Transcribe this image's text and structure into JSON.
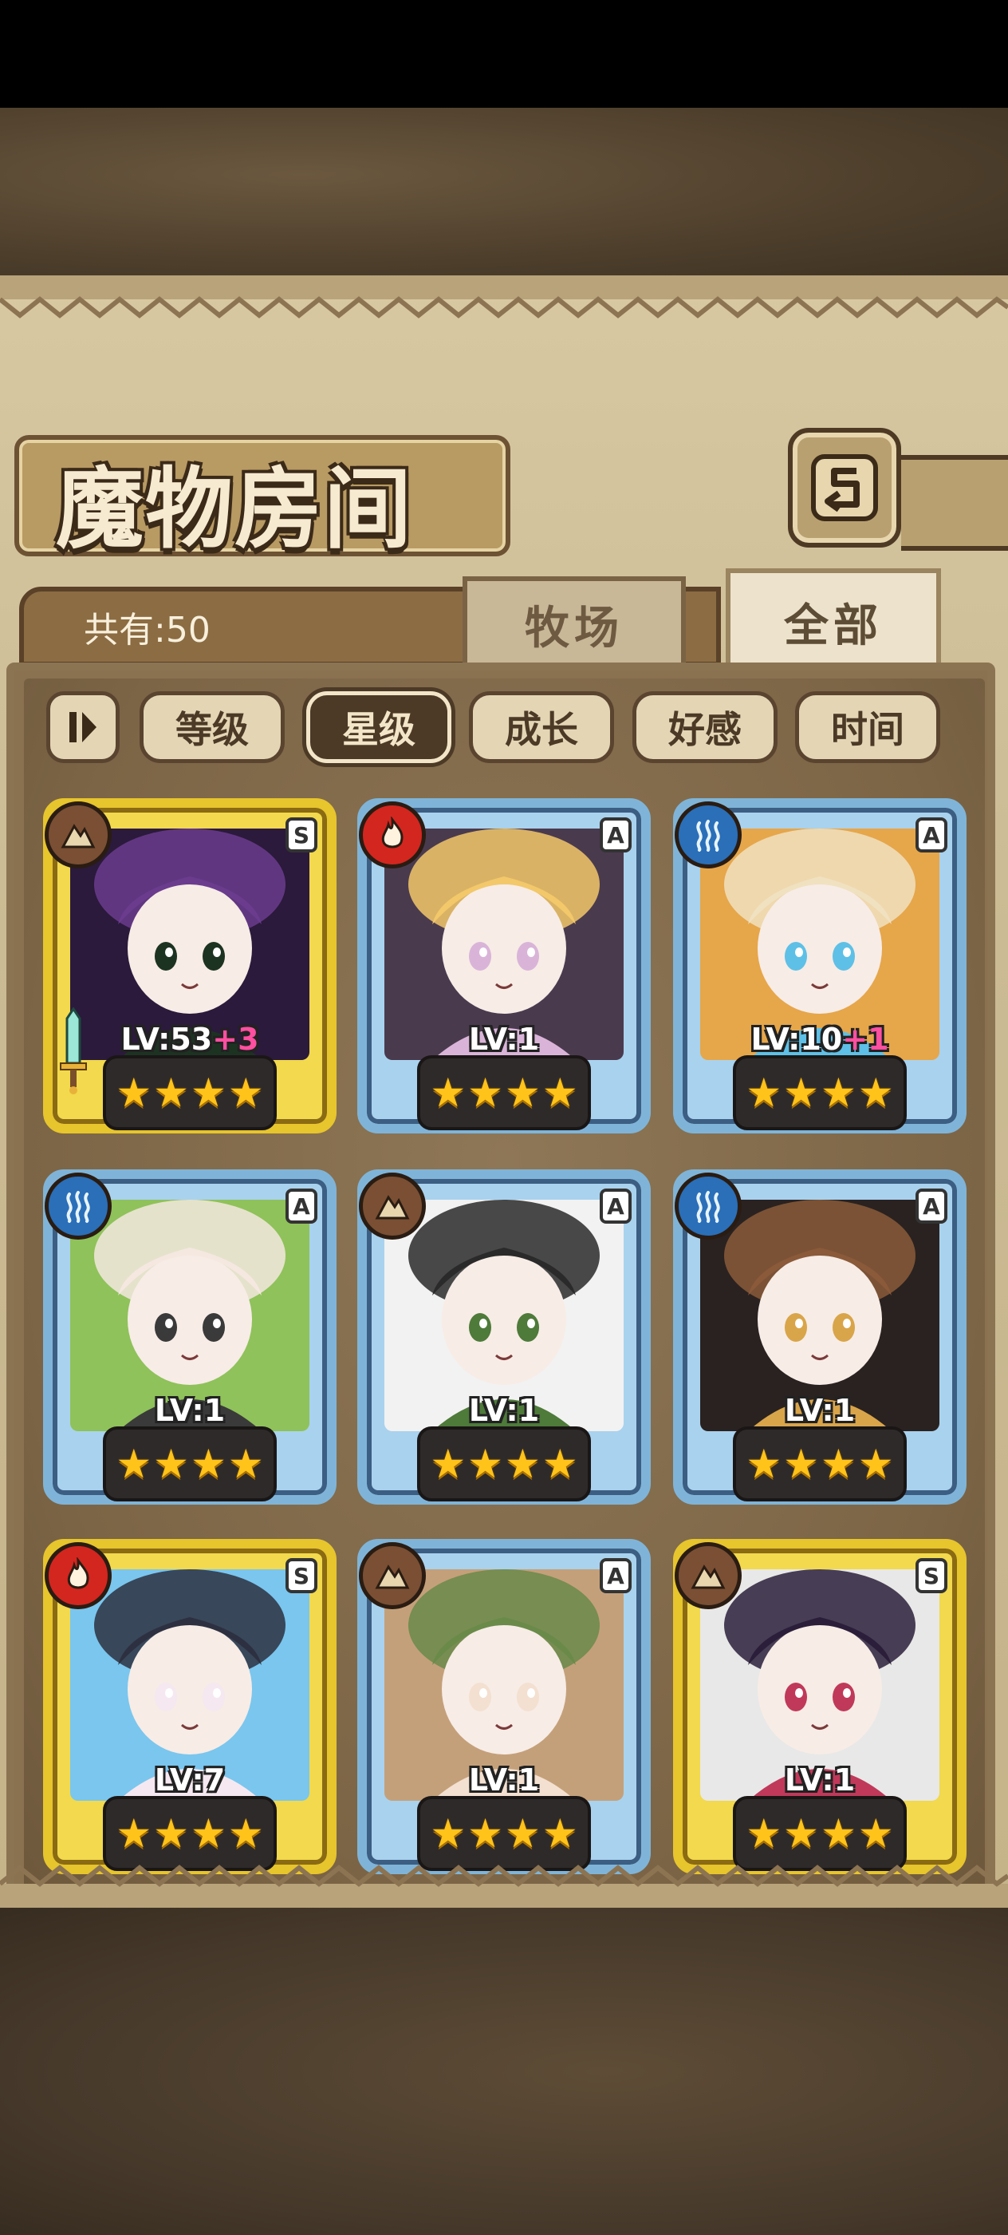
{
  "header": {
    "title": "魔物房间",
    "back_icon": "back-arrow-icon"
  },
  "summary": {
    "count_label": "共有:50"
  },
  "tabs": [
    {
      "label": "牧场",
      "active": false
    },
    {
      "label": "全部",
      "active": true
    }
  ],
  "sort_buttons": [
    {
      "label": "等级",
      "active": false
    },
    {
      "label": "星级",
      "active": true
    },
    {
      "label": "成长",
      "active": false
    },
    {
      "label": "好感",
      "active": false
    },
    {
      "label": "时间",
      "active": false
    }
  ],
  "cards": [
    {
      "level_text": "LV:53",
      "bonus": "+3",
      "rank": "S",
      "element": "earth",
      "stars": 4,
      "portrait_colors": [
        "#2b1a3b",
        "#6b3c8e",
        "#1d3322"
      ],
      "weapon": true
    },
    {
      "level_text": "LV:1",
      "bonus": "",
      "rank": "A",
      "element": "fire",
      "stars": 4,
      "portrait_colors": [
        "#4a3a4e",
        "#f2c86a",
        "#d9b4d8"
      ]
    },
    {
      "level_text": "LV:10",
      "bonus": "+1",
      "rank": "A",
      "element": "water",
      "stars": 4,
      "portrait_colors": [
        "#e6a64a",
        "#f0e1c0",
        "#5ec0e6"
      ]
    },
    {
      "level_text": "LV:1",
      "bonus": "",
      "rank": "A",
      "element": "water",
      "stars": 4,
      "portrait_colors": [
        "#8fc25a",
        "#f5e8e0",
        "#3a3a3a"
      ]
    },
    {
      "level_text": "LV:1",
      "bonus": "",
      "rank": "A",
      "element": "earth",
      "stars": 4,
      "portrait_colors": [
        "#f2f2f2",
        "#2a2a2a",
        "#4e7a3a"
      ]
    },
    {
      "level_text": "LV:1",
      "bonus": "",
      "rank": "A",
      "element": "water",
      "stars": 4,
      "portrait_colors": [
        "#2a2220",
        "#8a5a3a",
        "#d9a54a"
      ]
    },
    {
      "level_text": "LV:7",
      "bonus": "",
      "rank": "S",
      "element": "fire",
      "stars": 4,
      "portrait_colors": [
        "#7ac6ee",
        "#2d3040",
        "#f6e8f0"
      ]
    },
    {
      "level_text": "LV:1",
      "bonus": "",
      "rank": "A",
      "element": "earth",
      "stars": 4,
      "portrait_colors": [
        "#c4a07a",
        "#6a8a4a",
        "#f3e0d0"
      ]
    },
    {
      "level_text": "LV:1",
      "bonus": "",
      "rank": "S",
      "element": "earth",
      "stars": 4,
      "portrait_colors": [
        "#e8e8e8",
        "#2a1e3a",
        "#c0395a"
      ]
    }
  ],
  "colors": {
    "rank_A_frame": "#7fb4d8",
    "rank_S_frame": "#e7c52c",
    "star": "#ffc319",
    "bonus": "#ff4fa0",
    "earth": "#7a4f33",
    "fire": "#d3261f",
    "water": "#2a6fb8"
  }
}
